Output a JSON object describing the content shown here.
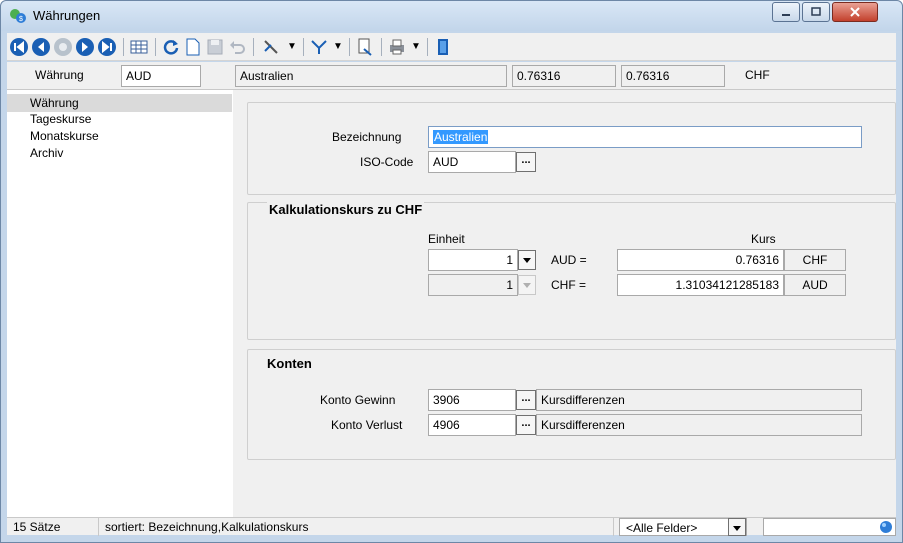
{
  "window": {
    "title": "Währungen",
    "controls": [
      "minimize-icon",
      "maximize-icon",
      "close-icon"
    ]
  },
  "toolbar": {
    "buttons": [
      "first-record-icon",
      "previous-record-icon",
      "stop-icon",
      "next-record-icon",
      "last-record-icon",
      "table-view-icon",
      "refresh-icon",
      "new-record-icon",
      "save-icon",
      "undo-icon",
      "tools-icon",
      "filter-icon",
      "export-icon",
      "print-icon",
      "exit-icon"
    ]
  },
  "header": {
    "waehrung_label": "Währung",
    "waehrung_code": "AUD",
    "name": "Australien",
    "rate1": "0.76316",
    "rate2": "0.76316",
    "base_currency": "CHF"
  },
  "nav": {
    "items": [
      {
        "label": "Währung",
        "selected": true
      },
      {
        "label": "Tageskurse",
        "selected": false
      },
      {
        "label": "Monatskurse",
        "selected": false
      },
      {
        "label": "Archiv",
        "selected": false
      }
    ]
  },
  "general": {
    "bezeichnung_label": "Bezeichnung",
    "bezeichnung_value": "Australien",
    "iso_label": "ISO-Code",
    "iso_value": "AUD",
    "ellipsis": "..."
  },
  "kalkulation": {
    "title": "Kalkulationskurs zu CHF",
    "einheit_label": "Einheit",
    "kurs_label": "Kurs",
    "row1": {
      "einheit": "1",
      "from": "AUD =",
      "kurs": "0.76316",
      "to": "CHF"
    },
    "row2": {
      "einheit": "1",
      "from": "CHF =",
      "kurs": "1.31034121285183",
      "to": "AUD"
    }
  },
  "konten": {
    "title": "Konten",
    "gewinn_label": "Konto Gewinn",
    "gewinn_value": "3906",
    "gewinn_desc": "Kursdifferenzen",
    "verlust_label": "Konto Verlust",
    "verlust_value": "4906",
    "verlust_desc": "Kursdifferenzen"
  },
  "status": {
    "count": "15 Sätze",
    "sort": "sortiert: Bezeichnung,Kalkulationskurs",
    "field_filter": "<Alle Felder>",
    "search_value": ""
  },
  "colors": {
    "accent": "#3399ff",
    "selection_bg": "#3399ff",
    "toolbar_blue": "#1a5fb4"
  }
}
